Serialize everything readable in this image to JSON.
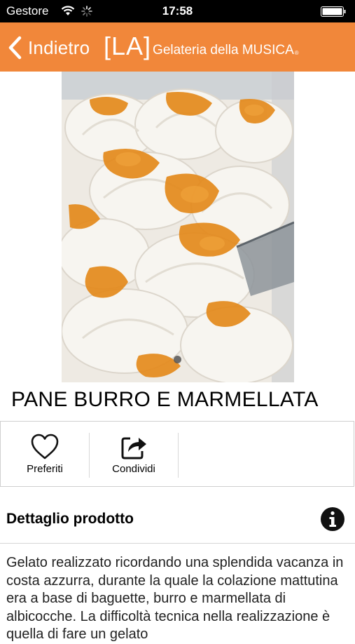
{
  "status_bar": {
    "carrier": "Gestore",
    "time": "17:58"
  },
  "nav": {
    "back_label": "Indietro",
    "brand_logo": "[LA]",
    "brand_name": "Gelateria della MUSICA",
    "brand_mark": "®"
  },
  "gallery": {
    "image_alt": "gelato con marmellata di albicocche",
    "pages": 1,
    "current_page": 1
  },
  "product": {
    "title": "PANE BURRO E MARMELLATA"
  },
  "actions": [
    {
      "label": "Preferiti",
      "icon": "heart-icon"
    },
    {
      "label": "Condividi",
      "icon": "share-icon"
    }
  ],
  "details": {
    "heading": "Dettaglio prodotto",
    "info_icon": "info-icon",
    "text": "Gelato realizzato ricordando una splendida vacanza in costa azzurra, durante la quale la colazione mattutina era a base di baguette, burro e marmellata di albicocche. La difficoltà tecnica nella realizzazione è quella di fare un gelato"
  },
  "colors": {
    "accent": "#f1873a",
    "status_bar": "#000000"
  }
}
